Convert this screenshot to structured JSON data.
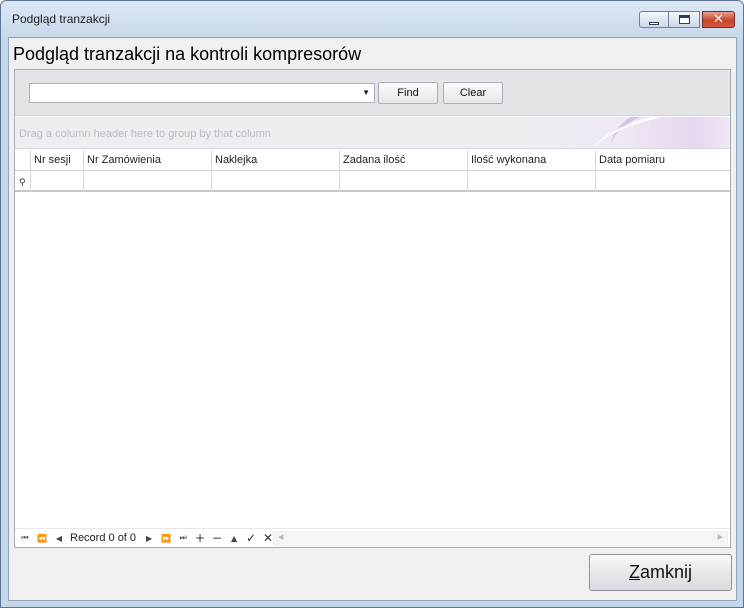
{
  "window": {
    "title": "Podgląd tranzakcji"
  },
  "heading": "Podgląd tranzakcji na kontroli kompresorów",
  "find_panel": {
    "search_value": "",
    "find_label": "Find",
    "clear_label": "Clear"
  },
  "grid": {
    "group_hint": "Drag a column header here to group by that column",
    "columns": [
      "Nr sesji",
      "Nr Zamówienia",
      "Naklejka",
      "Zadana ilość",
      "Ilość wykonana",
      "Data pomiaru"
    ],
    "rows": []
  },
  "navigator": {
    "record_text": "Record 0 of 0"
  },
  "footer": {
    "close_mnemonic": "Z",
    "close_rest": "amknij"
  },
  "icons": {
    "minimize": "minimize-icon",
    "maximize": "maximize-icon",
    "close": "close-icon",
    "filter": "filter-icon",
    "dropdown": "chevron-down-icon"
  },
  "colors": {
    "title_bar": "#c8d9ec",
    "close_button": "#c8452e",
    "panel_bg": "#e3e4e7"
  }
}
